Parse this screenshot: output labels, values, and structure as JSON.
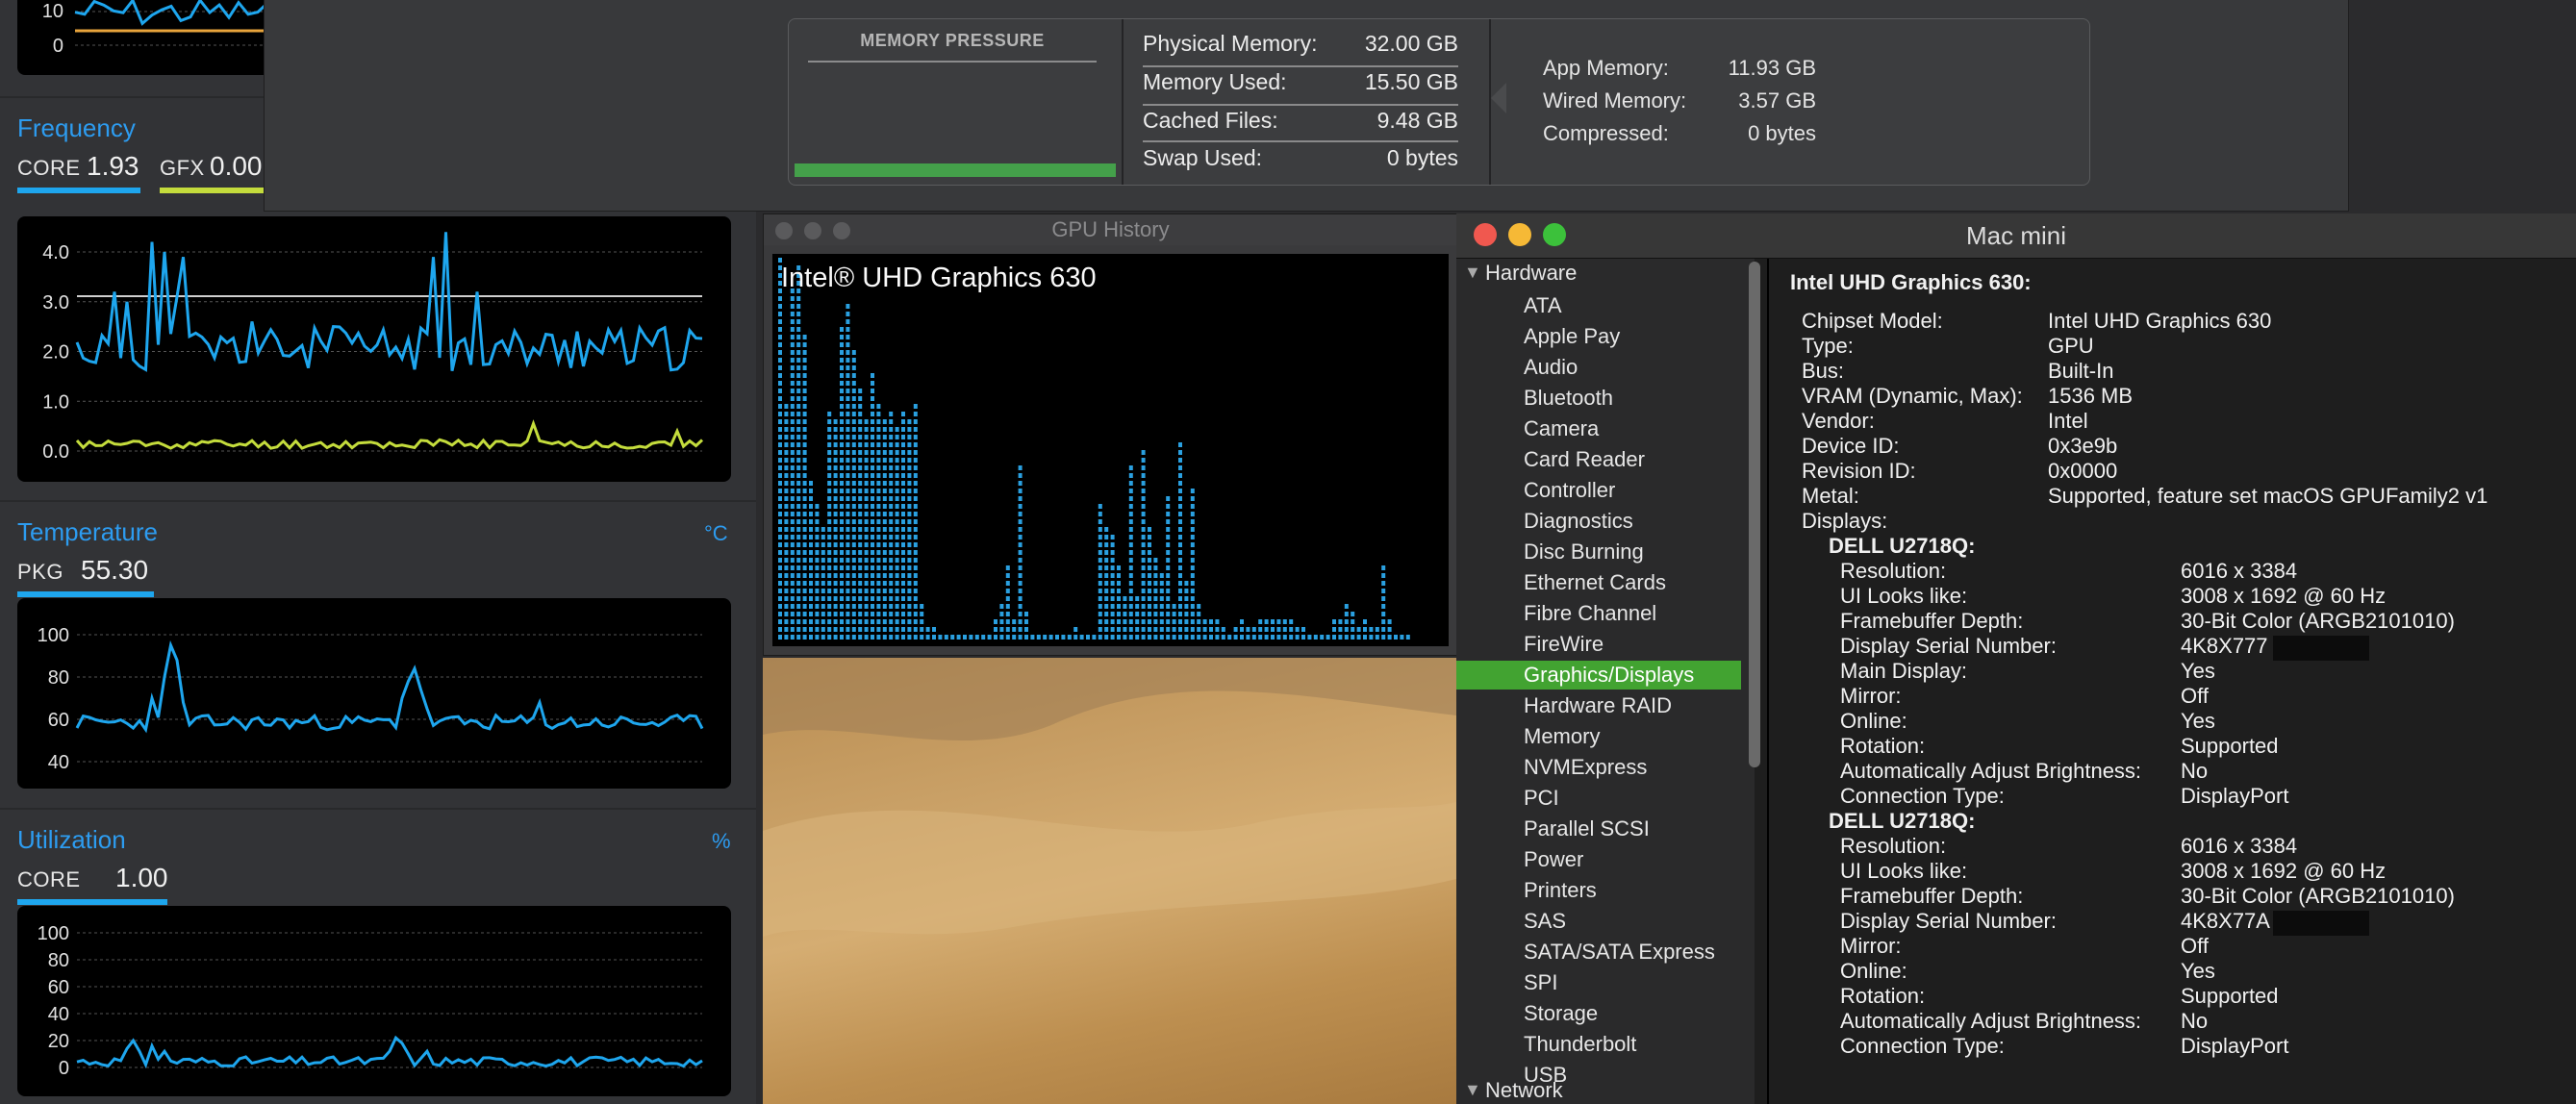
{
  "power_gadget": {
    "frequency": {
      "title": "Frequency",
      "core_label": "CORE",
      "core_value": "1.93",
      "gfx_label": "GFX",
      "gfx_value": "0.00",
      "y_ticks": [
        "4.0",
        "3.0",
        "2.0",
        "1.0",
        "0.0"
      ],
      "core_color": "#1ea6ee",
      "gfx_color": "#c4dc3c"
    },
    "temperature": {
      "title": "Temperature",
      "unit": "°C",
      "pkg_label": "PKG",
      "pkg_value": "55.30",
      "y_ticks": [
        "100",
        "80",
        "60",
        "40"
      ]
    },
    "utilization": {
      "title": "Utilization",
      "unit": "%",
      "core_label": "CORE",
      "core_value": "1.00",
      "y_ticks": [
        "100",
        "80",
        "60",
        "40",
        "20",
        "0"
      ]
    },
    "top_chart": {
      "y_ticks": [
        "10",
        "0"
      ]
    }
  },
  "memory": {
    "pressure_title": "MEMORY PRESSURE",
    "rows": [
      {
        "label": "Physical Memory:",
        "value": "32.00 GB"
      },
      {
        "label": "Memory Used:",
        "value": "15.50 GB"
      },
      {
        "label": "Cached Files:",
        "value": "9.48 GB"
      },
      {
        "label": "Swap Used:",
        "value": "0 bytes"
      }
    ],
    "detail": [
      {
        "label": "App Memory:",
        "value": "11.93 GB"
      },
      {
        "label": "Wired Memory:",
        "value": "3.57 GB"
      },
      {
        "label": "Compressed:",
        "value": "0 bytes"
      }
    ]
  },
  "gpu_history": {
    "title": "GPU History",
    "gpu_name": "Intel® UHD Graphics 630",
    "bar_color": "#2aa0e0"
  },
  "system_info": {
    "window_title": "Mac mini",
    "sidebar": {
      "hardware_label": "Hardware",
      "items": [
        "ATA",
        "Apple Pay",
        "Audio",
        "Bluetooth",
        "Camera",
        "Card Reader",
        "Controller",
        "Diagnostics",
        "Disc Burning",
        "Ethernet Cards",
        "Fibre Channel",
        "FireWire",
        "Graphics/Displays",
        "Hardware RAID",
        "Memory",
        "NVMExpress",
        "PCI",
        "Parallel SCSI",
        "Power",
        "Printers",
        "SAS",
        "SATA/SATA Express",
        "SPI",
        "Storage",
        "Thunderbolt",
        "USB"
      ],
      "selected": "Graphics/Displays",
      "network_label": "Network"
    },
    "heading": "Intel UHD Graphics 630:",
    "props": [
      {
        "k": "Chipset Model:",
        "v": "Intel UHD Graphics 630"
      },
      {
        "k": "Type:",
        "v": "GPU"
      },
      {
        "k": "Bus:",
        "v": "Built-In"
      },
      {
        "k": "VRAM (Dynamic, Max):",
        "v": "1536 MB"
      },
      {
        "k": "Vendor:",
        "v": "Intel"
      },
      {
        "k": "Device ID:",
        "v": "0x3e9b"
      },
      {
        "k": "Revision ID:",
        "v": "0x0000"
      },
      {
        "k": "Metal:",
        "v": "Supported, feature set macOS GPUFamily2 v1"
      },
      {
        "k": "Displays:",
        "v": ""
      }
    ],
    "displays": [
      {
        "name": "DELL U2718Q:",
        "props": [
          {
            "k": "Resolution:",
            "v": "6016 x 3384"
          },
          {
            "k": "UI Looks like:",
            "v": "3008 x 1692 @ 60 Hz"
          },
          {
            "k": "Framebuffer Depth:",
            "v": "30-Bit Color (ARGB2101010)"
          },
          {
            "k": "Display Serial Number:",
            "v": "4K8X777"
          },
          {
            "k": "Main Display:",
            "v": "Yes"
          },
          {
            "k": "Mirror:",
            "v": "Off"
          },
          {
            "k": "Online:",
            "v": "Yes"
          },
          {
            "k": "Rotation:",
            "v": "Supported"
          },
          {
            "k": "Automatically Adjust Brightness:",
            "v": "No"
          },
          {
            "k": "Connection Type:",
            "v": "DisplayPort"
          }
        ]
      },
      {
        "name": "DELL U2718Q:",
        "props": [
          {
            "k": "Resolution:",
            "v": "6016 x 3384"
          },
          {
            "k": "UI Looks like:",
            "v": "3008 x 1692 @ 60 Hz"
          },
          {
            "k": "Framebuffer Depth:",
            "v": "30-Bit Color (ARGB2101010)"
          },
          {
            "k": "Display Serial Number:",
            "v": "4K8X77A"
          },
          {
            "k": "Mirror:",
            "v": "Off"
          },
          {
            "k": "Online:",
            "v": "Yes"
          },
          {
            "k": "Rotation:",
            "v": "Supported"
          },
          {
            "k": "Automatically Adjust Brightness:",
            "v": "No"
          },
          {
            "k": "Connection Type:",
            "v": "DisplayPort"
          }
        ]
      }
    ],
    "traffic_lights": {
      "close": "#f0584f",
      "minimize": "#f6b936",
      "zoom": "#3cc13b"
    }
  }
}
